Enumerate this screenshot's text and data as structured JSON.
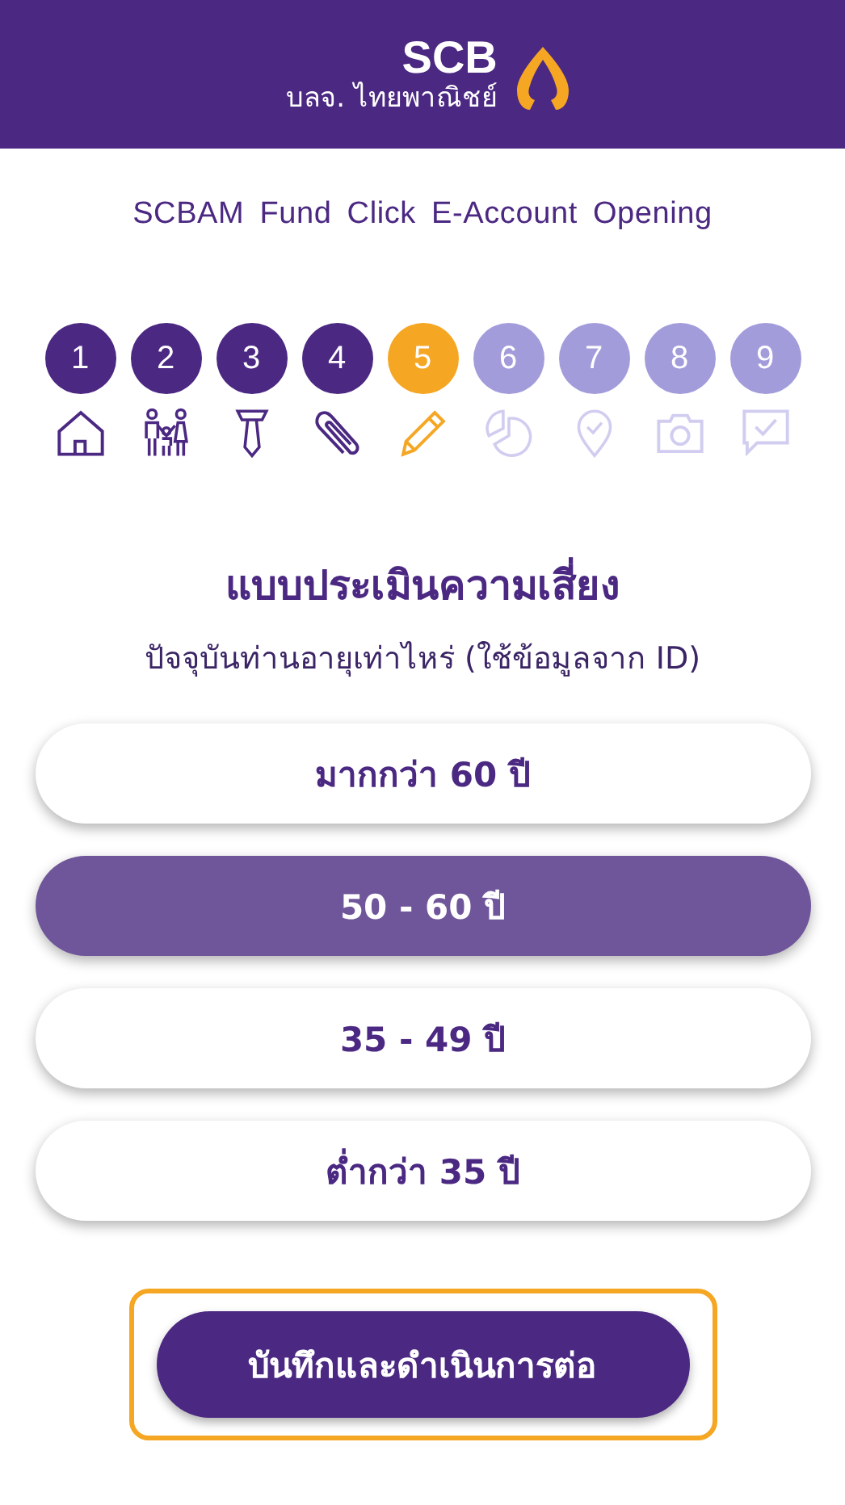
{
  "header": {
    "logo_text": "SCB",
    "logo_subtext": "บลจ. ไทยพาณิชย์"
  },
  "page_title": "SCBAM Fund Click E-Account Opening",
  "steps": [
    {
      "label": "1",
      "kind": "home",
      "completed": true,
      "selected": false
    },
    {
      "label": "2",
      "kind": "family",
      "completed": true,
      "selected": false
    },
    {
      "label": "3",
      "kind": "tie",
      "completed": true,
      "selected": false
    },
    {
      "label": "4",
      "kind": "clip",
      "completed": true,
      "selected": false
    },
    {
      "label": "5",
      "kind": "pencil",
      "completed": false,
      "selected": true
    },
    {
      "label": "6",
      "kind": "chart",
      "completed": false,
      "selected": false
    },
    {
      "label": "7",
      "kind": "pin",
      "completed": false,
      "selected": false
    },
    {
      "label": "8",
      "kind": "camera",
      "completed": false,
      "selected": false
    },
    {
      "label": "9",
      "kind": "chat",
      "completed": false,
      "selected": false
    }
  ],
  "heading": "แบบประเมินความเสี่ยง",
  "question": "ปัจจุบันท่านอายุเท่าไหร่ (ใช้ข้อมูลจาก ID)",
  "options": [
    {
      "label": "มากกว่า 60 ปี",
      "selected": false
    },
    {
      "label": "50 - 60 ปี",
      "selected": true
    },
    {
      "label": "35 - 49 ปี",
      "selected": false
    },
    {
      "label": "ต่ำกว่า 35 ปี",
      "selected": false
    }
  ],
  "submit_button": "บันทึกและดำเนินการต่อ"
}
